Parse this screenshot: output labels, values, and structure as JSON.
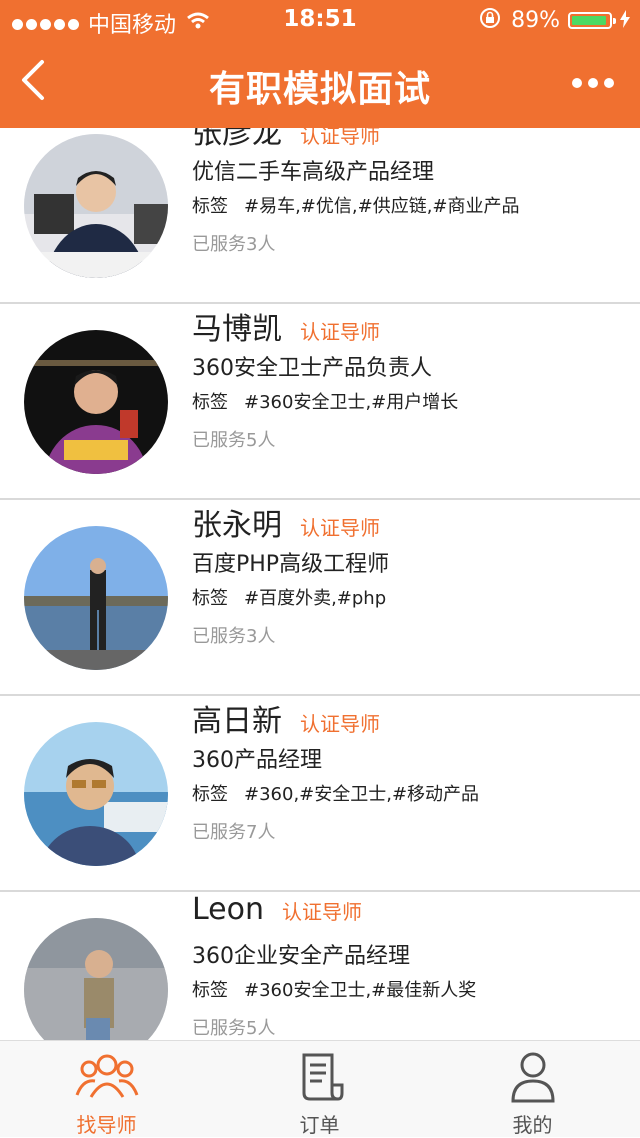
{
  "status": {
    "carrier": "中国移动",
    "time": "18:51",
    "battery": "89%"
  },
  "nav": {
    "title": "有职模拟面试"
  },
  "mentors": [
    {
      "name": "张彦龙",
      "cert": "认证导师",
      "role": "优信二手车高级产品经理",
      "tags_label": "标签",
      "tags": "#易车,#优信,#供应链,#商业产品",
      "served": "已服务3人"
    },
    {
      "name": "马博凯",
      "cert": "认证导师",
      "role": "360安全卫士产品负责人",
      "tags_label": "标签",
      "tags": "#360安全卫士,#用户增长",
      "served": "已服务5人"
    },
    {
      "name": "张永明",
      "cert": "认证导师",
      "role": "百度PHP高级工程师",
      "tags_label": "标签",
      "tags": "#百度外卖,#php",
      "served": "已服务3人"
    },
    {
      "name": "高日新",
      "cert": "认证导师",
      "role": "360产品经理",
      "tags_label": "标签",
      "tags": "#360,#安全卫士,#移动产品",
      "served": "已服务7人"
    },
    {
      "name": "Leon",
      "cert": "认证导师",
      "role": "360企业安全产品经理",
      "tags_label": "标签",
      "tags": "#360安全卫士,#最佳新人奖",
      "served": "已服务5人"
    }
  ],
  "tabbar": {
    "tabs": [
      {
        "label": "找导师",
        "icon": "people-icon",
        "active": true
      },
      {
        "label": "订单",
        "icon": "receipt-icon",
        "active": false
      },
      {
        "label": "我的",
        "icon": "user-icon",
        "active": false
      }
    ]
  },
  "colors": {
    "accent": "#f07030",
    "active_tab": "#f07030",
    "inactive_tab": "#555555"
  }
}
